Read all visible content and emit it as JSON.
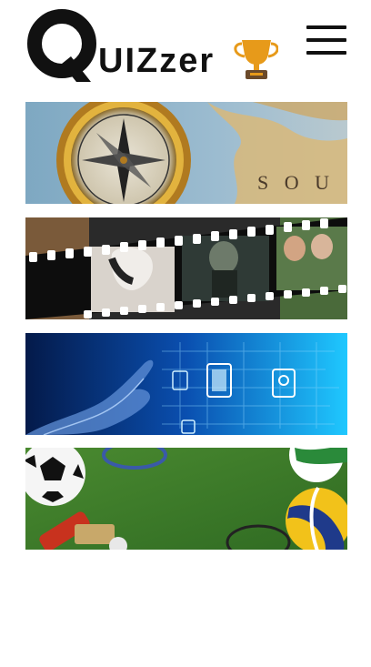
{
  "header": {
    "logo_letter": "Q",
    "logo_rest": "UIZzer",
    "trophy_icon": "trophy-icon",
    "menu_icon": "hamburger-menu-icon"
  },
  "categories": [
    {
      "name": "geography",
      "theme": "compass-on-map",
      "colors": [
        "#8fb3c9",
        "#c79a4a"
      ]
    },
    {
      "name": "movies",
      "theme": "film-strip",
      "colors": [
        "#111111",
        "#5a6a4a"
      ]
    },
    {
      "name": "technology",
      "theme": "digital-hand",
      "colors": [
        "#062a6e",
        "#1fb6ff"
      ]
    },
    {
      "name": "sports",
      "theme": "sports-balls-on-grass",
      "colors": [
        "#3f7a2a",
        "#f2c21a"
      ]
    }
  ],
  "colors": {
    "text": "#111111",
    "trophy_gold": "#e79a1a",
    "trophy_base": "#6b4a2a"
  }
}
